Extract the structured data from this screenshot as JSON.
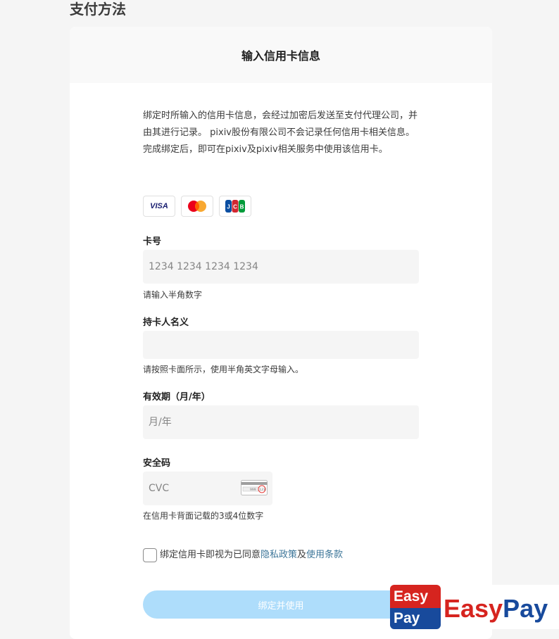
{
  "page": {
    "title": "支付方法"
  },
  "card": {
    "header": "输入信用卡信息",
    "description": "绑定时所输入的信用卡信息，会经过加密后发送至支付代理公司，并由其进行记录。 pixiv股份有限公司不会记录任何信用卡相关信息。 完成绑定后，即可在pixiv及pixiv相关服务中使用该信用卡。",
    "brands": [
      {
        "name": "VISA",
        "icon": "visa-logo"
      },
      {
        "name": "Mastercard",
        "icon": "mastercard-logo"
      },
      {
        "name": "JCB",
        "icon": "jcb-logo"
      }
    ]
  },
  "form": {
    "card_number": {
      "label": "卡号",
      "placeholder": "1234 1234 1234 1234",
      "value": "",
      "hint": "请输入半角数字"
    },
    "holder_name": {
      "label": "持卡人名义",
      "placeholder": "",
      "value": "",
      "hint": "请按照卡面所示，使用半角英文字母输入。"
    },
    "expiry": {
      "label": "有效期（月/年）",
      "placeholder": "月/年",
      "value": ""
    },
    "cvc": {
      "label": "安全码",
      "placeholder": "CVC",
      "value": "",
      "hint": "在信用卡背面记载的3或4位数字",
      "card_digits": "999",
      "card_code": "123"
    }
  },
  "agreement": {
    "checked": false,
    "prefix": "绑定信用卡即视为已同意",
    "privacy_link": "隐私政策",
    "middle": "及",
    "terms_link": "使用条款"
  },
  "submit_label": "绑定并使用",
  "watermark": {
    "badge_top": "Easy",
    "badge_bottom": "Pay",
    "word_easy": "Easy",
    "word_pay": "Pay"
  },
  "colors": {
    "accent": "#3d7699",
    "button_disabled": "#aeddfb",
    "input_bg": "#f5f5f5"
  }
}
